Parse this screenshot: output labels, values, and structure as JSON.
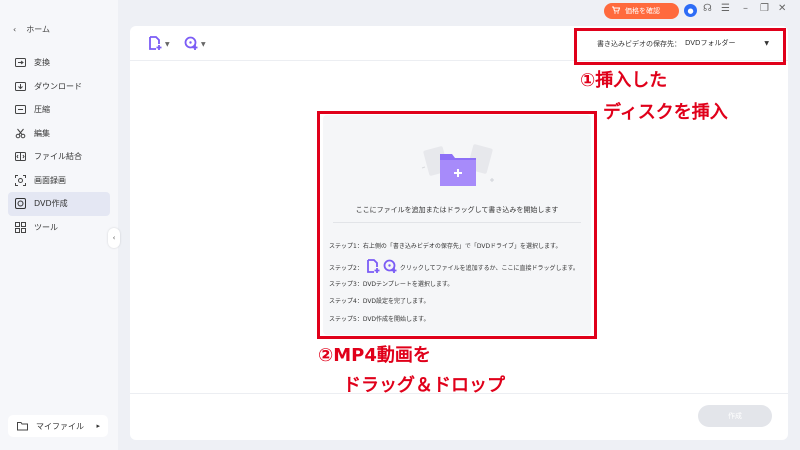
{
  "sidebar": {
    "home_label": "ホーム",
    "items": [
      {
        "label": "変換",
        "icon": "convert-icon"
      },
      {
        "label": "ダウンロード",
        "icon": "download-icon"
      },
      {
        "label": "圧縮",
        "icon": "compress-icon"
      },
      {
        "label": "編集",
        "icon": "scissors-icon"
      },
      {
        "label": "ファイル結合",
        "icon": "merge-icon"
      },
      {
        "label": "画面録画",
        "icon": "screen-record-icon"
      },
      {
        "label": "DVD作成",
        "icon": "dvd-icon",
        "active": true
      },
      {
        "label": "ツール",
        "icon": "tools-grid-icon"
      }
    ],
    "bottom_label": "マイファイル"
  },
  "titlebar": {
    "price_label": "価格を確認"
  },
  "toolbar": {
    "dest_label": "書き込みビデオの保存先：",
    "dest_value": "DVDフォルダー"
  },
  "dropzone": {
    "main_text": "ここにファイルを追加またはドラッグして書き込みを開始します",
    "step1": "ステップ1：右上側の「書き込みビデオの保存先」で「DVDドライブ」を選択します。",
    "step2_prefix": "ステップ2：",
    "step2_suffix": "クリックしてファイルを追加するか、ここに直接ドラッグします。",
    "step3": "ステップ3：DVDテンプレートを選択します。",
    "step4": "ステップ4：DVD設定を完了します。",
    "step5": "ステップ5：DVD作成を開始します。"
  },
  "footer": {
    "create_label": "作成"
  },
  "annotations": {
    "a1_line1": "①挿入した",
    "a1_line2": "ディスクを挿入",
    "a2_line1": "②MP4動画を",
    "a2_line2": "ドラッグ＆ドロップ"
  },
  "colors": {
    "accent": "#7b5cf5",
    "price_button": "#ff6a3d",
    "annotation_red": "#e0001a"
  }
}
